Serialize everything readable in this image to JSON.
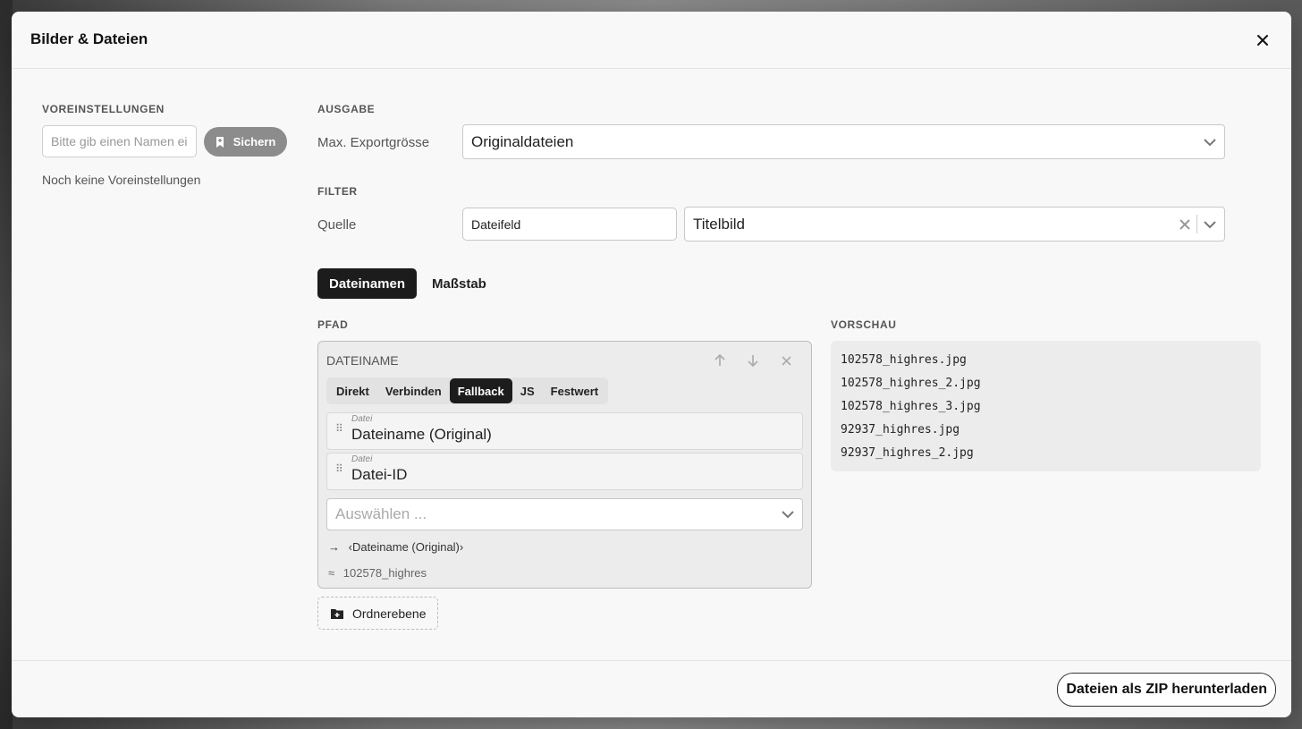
{
  "modal": {
    "title": "Bilder & Dateien"
  },
  "presets": {
    "section_label": "VOREINSTELLUNGEN",
    "name_placeholder": "Bitte gib einen Namen ein",
    "save_label": "Sichern",
    "empty_text": "Noch keine Voreinstellungen"
  },
  "output": {
    "section_label": "AUSGABE",
    "max_size_label": "Max. Exportgrösse",
    "max_size_value": "Originaldateien"
  },
  "filter": {
    "section_label": "FILTER",
    "source_label": "Quelle",
    "source_field_value": "Dateifeld",
    "source_select_value": "Titelbild"
  },
  "tabs": [
    {
      "label": "Dateinamen",
      "active": true
    },
    {
      "label": "Maßstab",
      "active": false
    }
  ],
  "path": {
    "section_label": "PFAD",
    "block_title": "DATEINAME",
    "modes": [
      "Direkt",
      "Verbinden",
      "Fallback",
      "JS",
      "Festwert"
    ],
    "active_mode": "Fallback",
    "items": [
      {
        "type_label": "Datei",
        "value": "Dateiname (Original)"
      },
      {
        "type_label": "Datei",
        "value": "Datei-ID"
      }
    ],
    "select_placeholder": "Auswählen ...",
    "result_arrow": "→",
    "result_expr": "‹Dateiname (Original)›",
    "approx_symbol": "≈",
    "approx_value": "102578_highres",
    "add_folder_label": "Ordnerebene"
  },
  "preview": {
    "section_label": "VORSCHAU",
    "files": [
      "102578_highres.jpg",
      "102578_highres_2.jpg",
      "102578_highres_3.jpg",
      "92937_highres.jpg",
      "92937_highres_2.jpg"
    ]
  },
  "footer": {
    "download_label": "Dateien als ZIP herunterladen"
  }
}
